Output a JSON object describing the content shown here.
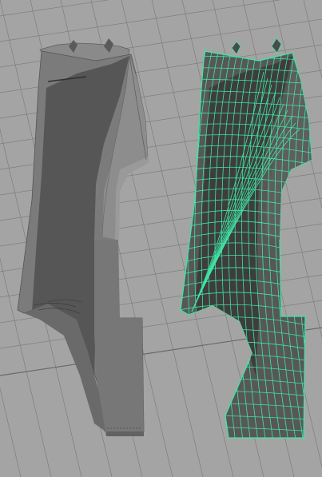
{
  "viewport": {
    "background_color": "#a4a4a4",
    "grid_color": "#7e7e7e",
    "grid_dark_color": "#6a6a6a"
  },
  "models": [
    {
      "name": "pants-leg-shaded",
      "shading": "smooth-shaded",
      "base_color": "#7a7a7a",
      "shadow_color": "#4a4a4a",
      "highlight_color": "#8f8f8f"
    },
    {
      "name": "pants-leg-wireframe",
      "shading": "wireframe-on-shaded",
      "base_color": "#545454",
      "wire_color": "#3fe6a4",
      "shadow_color": "#3a3a3a"
    }
  ]
}
